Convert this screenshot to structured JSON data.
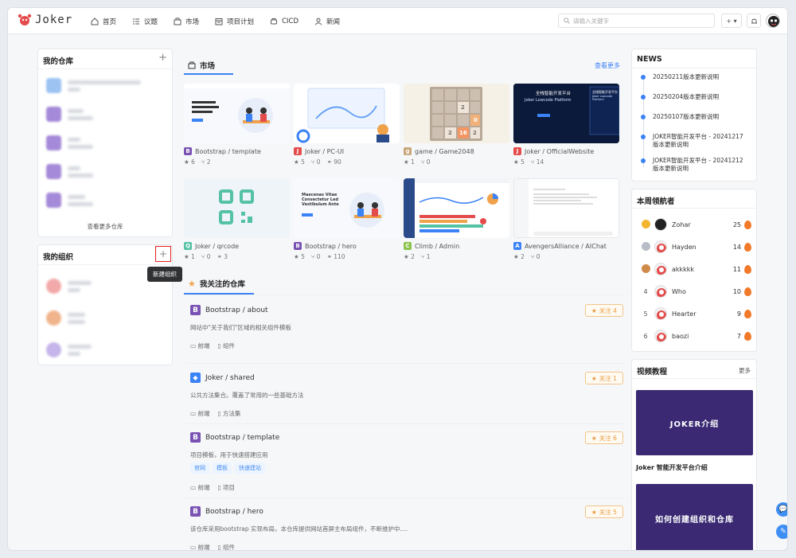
{
  "header": {
    "logo_text": "Joker",
    "nav": [
      {
        "label": "首页",
        "icon": "home-icon"
      },
      {
        "label": "议题",
        "icon": "list-icon"
      },
      {
        "label": "市场",
        "icon": "shop-icon"
      },
      {
        "label": "项目计划",
        "icon": "calendar-icon"
      },
      {
        "label": "CICD",
        "icon": "pipeline-icon"
      },
      {
        "label": "新闻",
        "icon": "person-icon"
      }
    ],
    "search_placeholder": "请输入关键字",
    "add_label": "+ ▾"
  },
  "left": {
    "repos_title": "我的仓库",
    "repos_more": "查看更多仓库",
    "orgs_title": "我的组织",
    "tooltip": "新建组织"
  },
  "market": {
    "title": "市场",
    "more": "查看更多",
    "items": [
      {
        "name": "Bootstrap / template",
        "stars": "6",
        "forks": "2",
        "links": "",
        "icon_color": "#7952b3",
        "icon_char": "B"
      },
      {
        "name": "Joker / PC-UI",
        "stars": "5",
        "forks": "0",
        "links": "90",
        "icon_color": "#e44b4b",
        "icon_char": "J"
      },
      {
        "name": "game / Game2048",
        "stars": "1",
        "forks": "0",
        "links": "",
        "icon_color": "#c9a57a",
        "icon_char": "g"
      },
      {
        "name": "Joker / OfficialWebsite",
        "stars": "5",
        "forks": "14",
        "links": "",
        "icon_color": "#e44b4b",
        "icon_char": "J"
      },
      {
        "name": "Joker / qrcode",
        "stars": "1",
        "forks": "0",
        "links": "3",
        "icon_color": "#55c2a5",
        "icon_char": "Q"
      },
      {
        "name": "Bootstrap / hero",
        "stars": "5",
        "forks": "0",
        "links": "110",
        "icon_color": "#7952b3",
        "icon_char": "B"
      },
      {
        "name": "Climb / Admin",
        "stars": "2",
        "forks": "1",
        "links": "",
        "icon_color": "#8bc34a",
        "icon_char": "C"
      },
      {
        "name": "AvengersAlliance / AIChat",
        "stars": "2",
        "forks": "0",
        "links": "",
        "icon_color": "#3b82f6",
        "icon_char": "A"
      }
    ],
    "thumb_text": {
      "hero_title": "Maecenas Vitae Consectetur Led Vestibulum Ante",
      "official_title": "全栈智能开发平台",
      "official_sub": "Joker Lowcode Platform",
      "official_title2": "全栈智能开发平台",
      "official_sub2": "Joker Lowcode Platform",
      "game_tiles": [
        "2",
        "0",
        "2",
        "16",
        "2"
      ]
    }
  },
  "favorites": {
    "title": "我关注的仓库",
    "items": [
      {
        "name": "Bootstrap / about",
        "desc": "网站中\"关于我们\"区域的相关组件模板",
        "follow": "关注 4",
        "meta1": "前端",
        "meta2": "组件",
        "tags": [],
        "icon_color": "#7952b3",
        "icon_char": "B"
      },
      {
        "name": "Joker / shared",
        "desc": "公共方法集合。覆盖了常用的一些基础方法",
        "follow": "关注 1",
        "meta1": "前端",
        "meta2": "方法集",
        "tags": [],
        "icon_color": "#3b82f6",
        "icon_char": "◆"
      },
      {
        "name": "Bootstrap / template",
        "desc": "项目模板，用于快速搭建应用",
        "follow": "关注 6",
        "meta1": "前端",
        "meta2": "项目",
        "tags": [
          "官网",
          "模板",
          "快速建站"
        ],
        "icon_color": "#7952b3",
        "icon_char": "B"
      },
      {
        "name": "Bootstrap / hero",
        "desc": "该仓库采用bootstrap 实现布局，本仓库提供网站首屏主布局组件，不断维护中....",
        "follow": "关注 5",
        "meta1": "前端",
        "meta2": "组件",
        "tags": [],
        "icon_color": "#7952b3",
        "icon_char": "B"
      }
    ]
  },
  "news": {
    "title": "NEWS",
    "items": [
      "20250211版本更新说明",
      "20250204版本更新说明",
      "20250107版本更新说明",
      "JOKER智能开发平台 - 20241217版本更新说明",
      "JOKER智能开发平台 - 20241212版本更新说明"
    ]
  },
  "leaders": {
    "title": "本周领航者",
    "rows": [
      {
        "rank": "",
        "medal": "#f2b530",
        "name": "Zohar",
        "score": "25"
      },
      {
        "rank": "",
        "medal": "#b7bcc6",
        "name": "Hayden",
        "score": "14"
      },
      {
        "rank": "",
        "medal": "#d08a4a",
        "name": "akkkkk",
        "score": "11"
      },
      {
        "rank": "4",
        "medal": "",
        "name": "Who",
        "score": "10"
      },
      {
        "rank": "5",
        "medal": "",
        "name": "Hearter",
        "score": "9"
      },
      {
        "rank": "6",
        "medal": "",
        "name": "baozi",
        "score": "7"
      }
    ]
  },
  "videos": {
    "title": "视频教程",
    "more": "更多",
    "items": [
      {
        "cover_text": "JOKER介绍",
        "caption": "Joker 智能开发平台介绍"
      },
      {
        "cover_text": "如何创建组织和仓库",
        "caption": ""
      }
    ]
  }
}
